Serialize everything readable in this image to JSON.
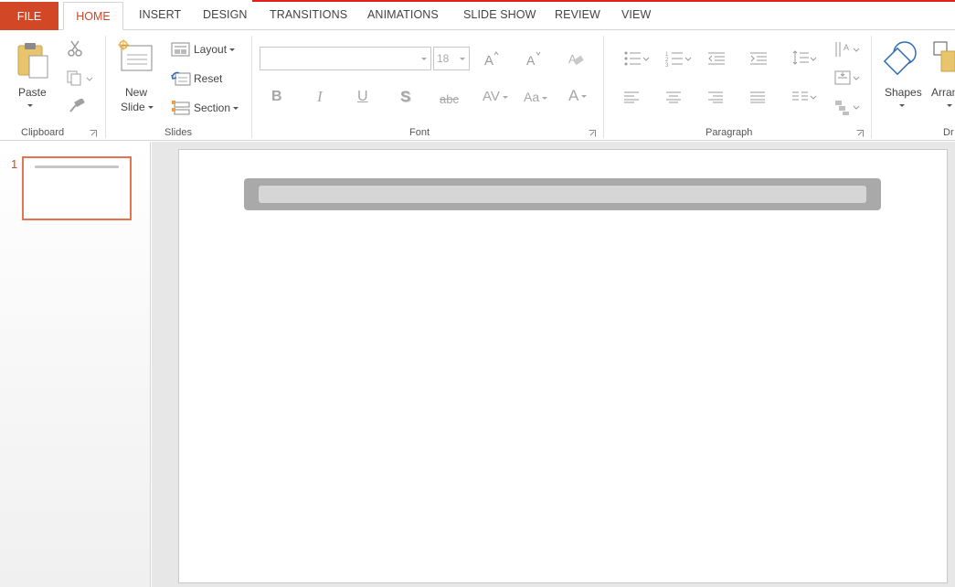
{
  "tabs": {
    "file": "FILE",
    "home": "HOME",
    "insert": "INSERT",
    "design": "DESIGN",
    "transitions": "TRANSITIONS",
    "animations": "ANIMATIONS",
    "slideshow": "SLIDE SHOW",
    "review": "REVIEW",
    "view": "VIEW"
  },
  "clipboard": {
    "label": "Clipboard",
    "paste": "Paste"
  },
  "slides": {
    "label": "Slides",
    "new_slide_line1": "New",
    "new_slide_line2": "Slide",
    "layout": "Layout",
    "reset": "Reset",
    "section": "Section"
  },
  "font": {
    "label": "Font",
    "name_value": "",
    "size_value": "18",
    "bold": "B",
    "italic": "I",
    "underline": "U",
    "shadow": "S",
    "strike": "abc",
    "spacing": "AV",
    "case": "Aa",
    "color": "A"
  },
  "paragraph": {
    "label": "Paragraph"
  },
  "drawing": {
    "shapes": "Shapes",
    "arrange": "Arran",
    "label": "Dr"
  },
  "slide_pane": {
    "slide_number": "1"
  },
  "colors": {
    "accent": "#d24726",
    "tab_red_line": "#e0201b"
  }
}
